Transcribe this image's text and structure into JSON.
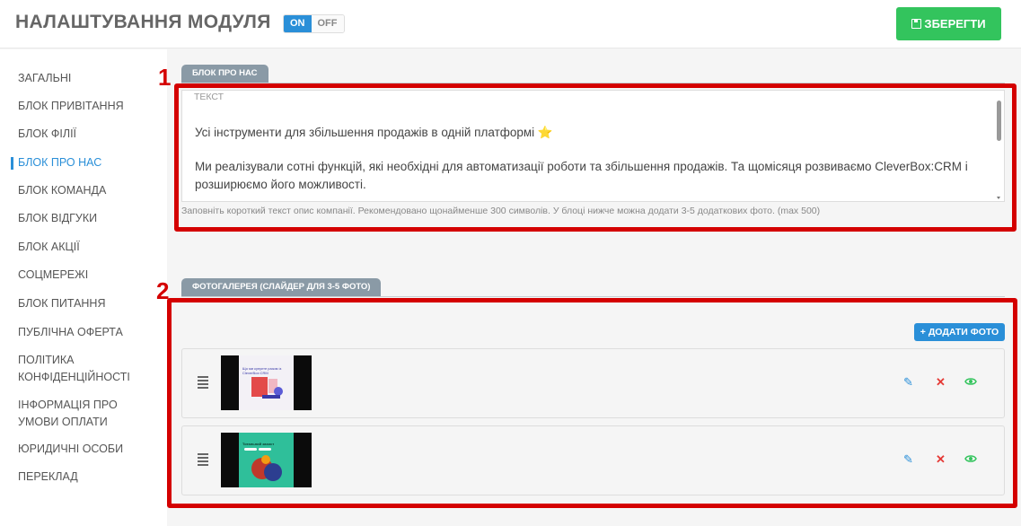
{
  "header": {
    "title": "НАЛАШТУВАННЯ МОДУЛЯ",
    "toggle_on": "ON",
    "toggle_off": "OFF",
    "save_label": "ЗБЕРЕГТИ"
  },
  "sidebar": {
    "items": [
      {
        "label": "ЗАГАЛЬНІ"
      },
      {
        "label": "БЛОК ПРИВІТАННЯ"
      },
      {
        "label": "БЛОК ФІЛІЇ"
      },
      {
        "label": "БЛОК ПРО НАС",
        "active": true
      },
      {
        "label": "БЛОК КОМАНДА"
      },
      {
        "label": "БЛОК ВІДГУКИ"
      },
      {
        "label": "БЛОК АКЦІЇ"
      },
      {
        "label": "СОЦМЕРЕЖІ"
      },
      {
        "label": "БЛОК ПИТАННЯ"
      },
      {
        "label": "ПУБЛІЧНА ОФЕРТА"
      },
      {
        "label": "ПОЛІТИКА КОНФІДЕНЦІЙНОСТІ",
        "line1": "ПОЛІТИКА",
        "line2": "КОНФІДЕНЦІЙНОСТІ"
      },
      {
        "label": "ІНФОРМАЦІЯ ПРО УМОВИ ОПЛАТИ",
        "line1": "ІНФОРМАЦІЯ ПРО",
        "line2": "УМОВИ ОПЛАТИ"
      },
      {
        "label": "ЮРИДИЧНІ ОСОБИ"
      },
      {
        "label": "ПЕРЕКЛАД"
      }
    ]
  },
  "about": {
    "tab_label": "БЛОК ПРО НАС",
    "annotation_number": "1",
    "field_label": "ТЕКСТ",
    "paragraph_1": "Усі інструменти для збільшення продажів в одній платформі",
    "paragraph_1_emoji": "⭐",
    "paragraph_2": "Ми реалізували сотні функцій, які необхідні для автоматизації роботи та збільшення продажів. Та щомісяця розвиваємо CleverBox:CRM і розширюємо його можливості.",
    "hint": "Заповніть короткий текст опис компанії. Рекомендовано щонайменше 300 символів. У блоці нижче можна додати 3-5 додаткових фото. (max 500)"
  },
  "gallery": {
    "tab_label": "ФОТОГАЛЕРЕЯ (СЛАЙДЕР ДЛЯ 3-5 ФОТО)",
    "annotation_number": "2",
    "add_label": "+ ДОДАТИ ФОТО",
    "photos": [
      {
        "caption": "Що ми купуєте разом із CleverBox:CRM"
      },
      {
        "caption": "Тотальний захист"
      }
    ],
    "icons": {
      "drag": "drag-handle-icon",
      "edit": "pencil-icon",
      "delete": "close-icon",
      "view": "eye-icon"
    }
  },
  "colors": {
    "accent": "#2a8fd8",
    "save": "#33c45d",
    "annotation": "#d40000",
    "tab": "#8a9aa6"
  }
}
